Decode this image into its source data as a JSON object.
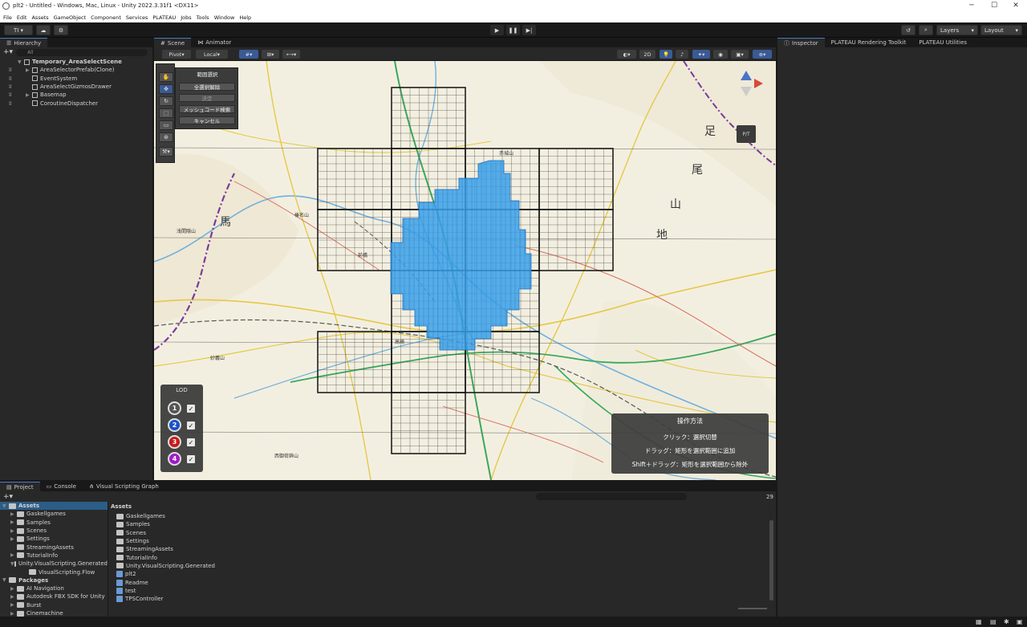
{
  "window": {
    "title": "plt2 - Untitled - Windows, Mac, Linux - Unity 2022.3.31f1 <DX11>",
    "minimize": "─",
    "maximize": "☐",
    "close": "✕"
  },
  "menu": [
    "File",
    "Edit",
    "Assets",
    "GameObject",
    "Component",
    "Services",
    "PLATEAU",
    "Jobs",
    "Tools",
    "Window",
    "Help"
  ],
  "toolbar": {
    "account": "TI ▾",
    "layers": "Layers",
    "layout": "Layout"
  },
  "hierarchy": {
    "tab": "Hierarchy",
    "search_placeholder": "All",
    "items": [
      {
        "label": "Temporary_AreaSelectScene",
        "indent": 0,
        "bold": true,
        "expander": "▼"
      },
      {
        "label": "AreaSelectorPrefab(Clone)",
        "indent": 1,
        "expander": "▶"
      },
      {
        "label": "EventSystem",
        "indent": 1,
        "expander": ""
      },
      {
        "label": "AreaSelectGizmosDrawer",
        "indent": 1,
        "expander": ""
      },
      {
        "label": "Basemap",
        "indent": 1,
        "expander": "▶"
      },
      {
        "label": "CoroutineDispatcher",
        "indent": 1,
        "expander": ""
      }
    ]
  },
  "scene": {
    "tabs": [
      "Scene",
      "Animator"
    ],
    "pivot": "Pivot",
    "local": "Local",
    "two_d": "2D",
    "persp": "P/T"
  },
  "area_menu": {
    "title": "範囲選択",
    "deselect_all": "全選択解除",
    "confirm": "決定",
    "mesh_search": "メッシュコード検索",
    "cancel": "キャンセル"
  },
  "lod": {
    "title": "LOD",
    "levels": [
      {
        "n": "1",
        "color": "#555555"
      },
      {
        "n": "2",
        "color": "#1a52c8"
      },
      {
        "n": "3",
        "color": "#c81a1a"
      },
      {
        "n": "4",
        "color": "#a21ac8"
      }
    ],
    "check": "✓"
  },
  "help": {
    "title": "操作方法",
    "line1": "クリック：選択切替",
    "line2": "ドラッグ：矩形を選択範囲に追加",
    "line3": "Shift＋ドラッグ：矩形を選択範囲から除外"
  },
  "map_labels": {
    "big1": "馬",
    "big2": "尾",
    "big3": "足",
    "big4": "地",
    "big5": "山",
    "peak1": "浅間隠山",
    "peak2": "榛名山",
    "peak3": "赤城山",
    "peak4": "妙義山",
    "peak5": "西御荷鉾山",
    "place1": "高崎",
    "place2": "前橋"
  },
  "inspector": {
    "tabs": [
      "Inspector",
      "PLATEAU Rendering Toolkit",
      "PLATEAU Utilities"
    ]
  },
  "project": {
    "tabs": [
      "Project",
      "Console",
      "Visual Scripting Graph"
    ],
    "count": "29",
    "tree_assets": "Assets",
    "tree": [
      "Gaskellgames",
      "Samples",
      "Scenes",
      "Settings",
      "StreamingAssets",
      "TutorialInfo",
      "Unity.VisualScripting.Generated",
      "VisualScripting.Flow"
    ],
    "packages": "Packages",
    "pkg": [
      "AI Navigation",
      "Autodesk FBX SDK for Unity",
      "Burst",
      "Cinemachine"
    ],
    "crumb": "Assets",
    "files": [
      "Gaskellgames",
      "Samples",
      "Scenes",
      "Settings",
      "StreamingAssets",
      "TutorialInfo",
      "Unity.VisualScripting.Generated",
      "plt2",
      "Readme",
      "test",
      "TPSController"
    ]
  }
}
